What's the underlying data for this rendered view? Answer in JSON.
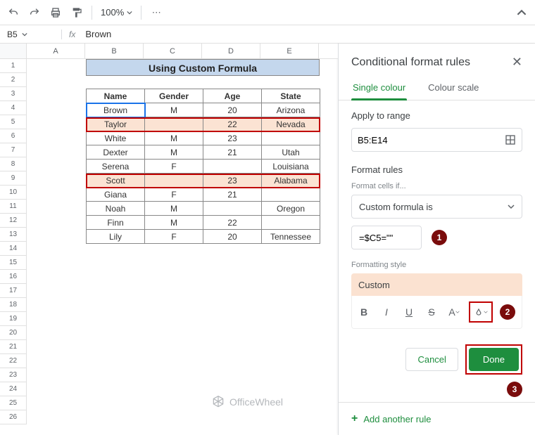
{
  "toolbar": {
    "zoom": "100%"
  },
  "formula_bar": {
    "cell_ref": "B5",
    "fx": "fx",
    "value": "Brown"
  },
  "columns": [
    "A",
    "B",
    "C",
    "D",
    "E"
  ],
  "row_count": 26,
  "title": "Using Custom Formula",
  "headers": [
    "Name",
    "Gender",
    "Age",
    "State"
  ],
  "rows": [
    {
      "name": "Brown",
      "gender": "M",
      "age": "20",
      "state": "Arizona",
      "hl": false,
      "selected": true
    },
    {
      "name": "Taylor",
      "gender": "",
      "age": "22",
      "state": "Nevada",
      "hl": true
    },
    {
      "name": "White",
      "gender": "M",
      "age": "23",
      "state": "",
      "hl": false
    },
    {
      "name": "Dexter",
      "gender": "M",
      "age": "21",
      "state": "Utah",
      "hl": false
    },
    {
      "name": "Serena",
      "gender": "F",
      "age": "",
      "state": "Louisiana",
      "hl": false
    },
    {
      "name": "Scott",
      "gender": "",
      "age": "23",
      "state": "Alabama",
      "hl": true
    },
    {
      "name": "Giana",
      "gender": "F",
      "age": "21",
      "state": "",
      "hl": false
    },
    {
      "name": "Noah",
      "gender": "M",
      "age": "",
      "state": "Oregon",
      "hl": false
    },
    {
      "name": "Finn",
      "gender": "M",
      "age": "22",
      "state": "",
      "hl": false
    },
    {
      "name": "Lily",
      "gender": "F",
      "age": "20",
      "state": "Tennessee",
      "hl": false
    }
  ],
  "panel": {
    "title": "Conditional format rules",
    "tabs": {
      "single": "Single colour",
      "scale": "Colour scale"
    },
    "apply_label": "Apply to range",
    "range": "B5:E14",
    "rules_label": "Format rules",
    "cells_if": "Format cells if...",
    "condition": "Custom formula is",
    "formula": "=$C5=\"\"",
    "style_label": "Formatting style",
    "style_name": "Custom",
    "cancel": "Cancel",
    "done": "Done",
    "add_rule": "Add another rule",
    "badges": {
      "b1": "1",
      "b2": "2",
      "b3": "3"
    }
  },
  "watermark": "OfficeWheel"
}
